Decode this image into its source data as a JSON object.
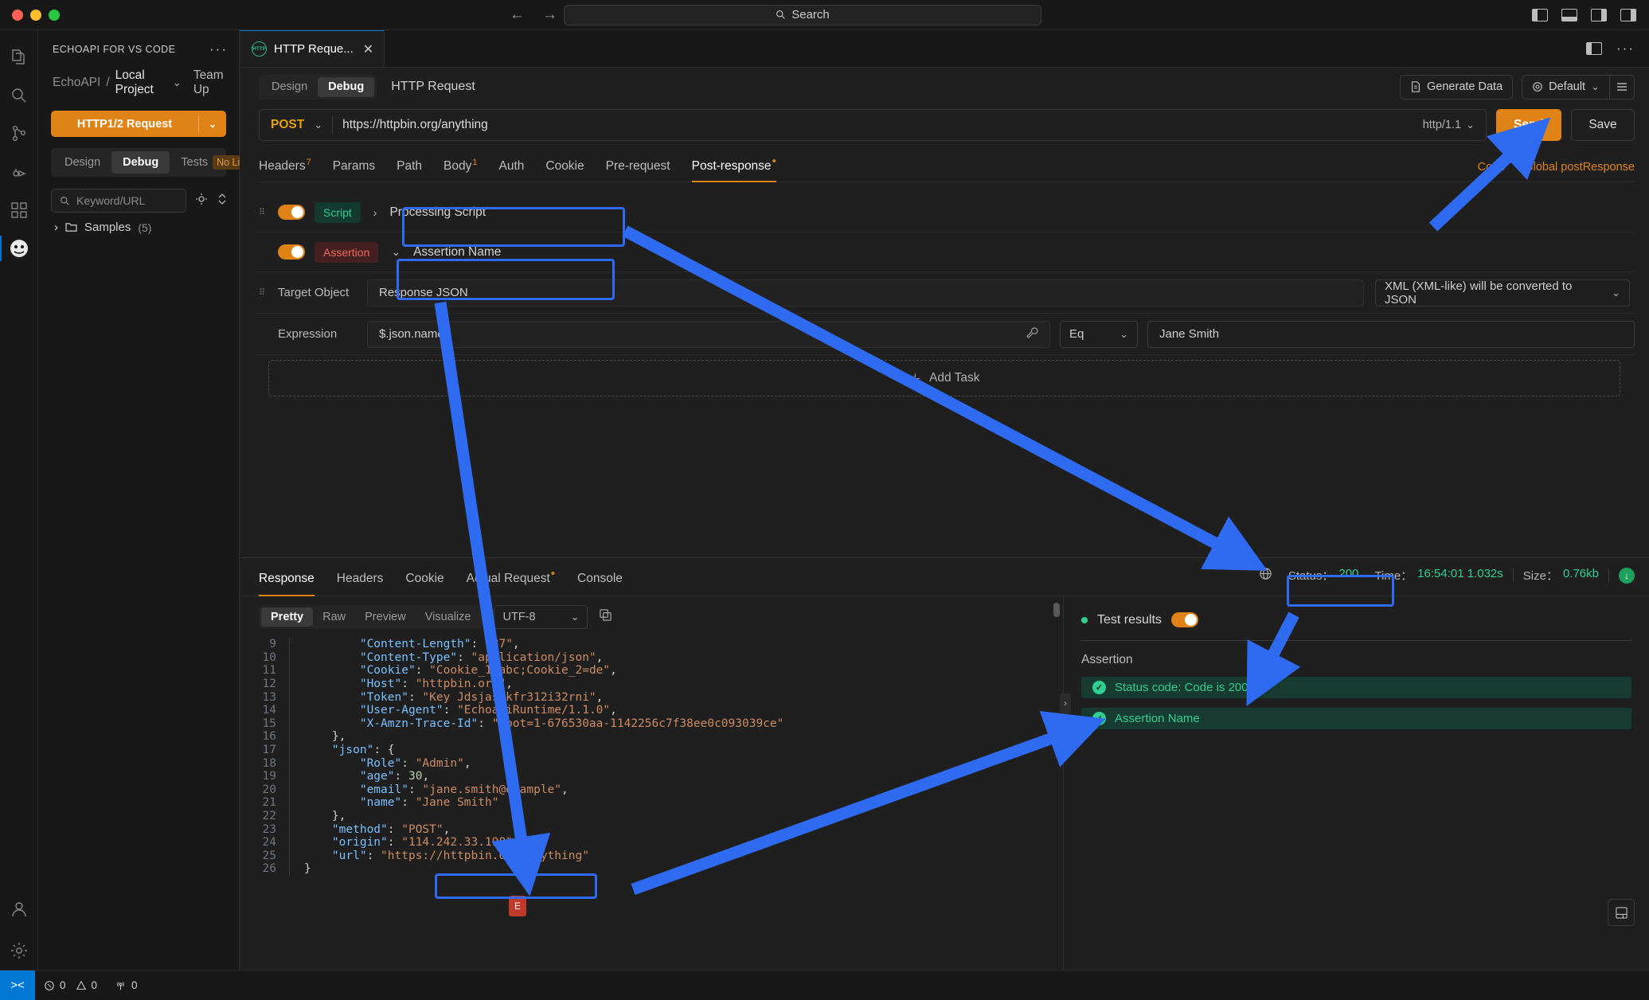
{
  "titlebar": {
    "search_placeholder": "Search",
    "back_icon": "arrow-left-icon",
    "forward_icon": "arrow-right-icon"
  },
  "sidebar": {
    "title": "ECHOAPI FOR VS CODE",
    "more_label": "···",
    "breadcrumb": {
      "root": "EchoAPI",
      "separator": "/",
      "project": "Local Project",
      "team_up": "Team Up"
    },
    "new_button": {
      "label": "HTTP1/2 Request",
      "caret": "⌄"
    },
    "segments": [
      {
        "label": "Design",
        "active": false
      },
      {
        "label": "Debug",
        "active": true
      },
      {
        "label": "Tests",
        "badge": "No Limits",
        "active": false
      }
    ],
    "search_placeholder": "Keyword/URL",
    "tree": [
      {
        "label": "Samples",
        "count": "(5)"
      }
    ]
  },
  "activity_items": [
    "explorer-icon",
    "search-icon",
    "source-control-icon",
    "run-debug-icon",
    "extensions-icon",
    "echoapi-icon",
    "account-icon",
    "settings-icon"
  ],
  "editor": {
    "tab": {
      "label": "HTTP Reque...",
      "icon": "http-icon",
      "close": "✕"
    },
    "mode_segments": [
      {
        "label": "Design",
        "active": false
      },
      {
        "label": "Debug",
        "active": true
      }
    ],
    "request_title": "HTTP Request",
    "generate_data": "Generate Data",
    "environment": "Default",
    "url_bar": {
      "method": "POST",
      "url": "https://httpbin.org/anything",
      "protocol": "http/1.1",
      "send": "Send",
      "save": "Save"
    },
    "request_tabs": [
      {
        "label": "Headers",
        "sup": "7",
        "active": false
      },
      {
        "label": "Params",
        "sup": "",
        "active": false
      },
      {
        "label": "Path",
        "sup": "",
        "active": false
      },
      {
        "label": "Body",
        "sup": "1",
        "active": false
      },
      {
        "label": "Auth",
        "sup": "",
        "active": false
      },
      {
        "label": "Cookie",
        "sup": "",
        "active": false
      },
      {
        "label": "Pre-request",
        "sup": "",
        "active": false
      },
      {
        "label": "Post-response",
        "sup": "•",
        "active": true
      }
    ],
    "tab_links": [
      "Code",
      "Global postResponse"
    ]
  },
  "tasks": {
    "script_row": {
      "chip": "Script",
      "arrow": "›",
      "name": "Processing Script"
    },
    "assertion_row": {
      "chip": "Assertion",
      "arrow": "⌄",
      "name": "Assertion Name"
    },
    "target_object": {
      "label": "Target Object",
      "value": "Response JSON",
      "note": "XML (XML-like) will be converted to JSON"
    },
    "expression": {
      "label": "Expression",
      "value": "$.json.name",
      "operator": "Eq",
      "expected": "Jane Smith"
    },
    "add_task": "Add Task"
  },
  "response": {
    "tabs": [
      {
        "label": "Response",
        "mark": "",
        "active": true
      },
      {
        "label": "Headers",
        "mark": "",
        "active": false
      },
      {
        "label": "Cookie",
        "mark": "",
        "active": false
      },
      {
        "label": "Actual Request",
        "mark": "•",
        "active": false
      },
      {
        "label": "Console",
        "mark": "",
        "active": false
      }
    ],
    "meta": {
      "status_label": "Status：",
      "status_value": "200",
      "time_label": "Time：",
      "time_value": "16:54:01 1.032s",
      "size_label": "Size：",
      "size_value": "0.76kb"
    },
    "format_segments": [
      {
        "label": "Pretty",
        "active": true
      },
      {
        "label": "Raw",
        "active": false
      },
      {
        "label": "Preview",
        "active": false
      },
      {
        "label": "Visualize",
        "active": false
      }
    ],
    "encoding": "UTF-8",
    "code_lines": [
      {
        "n": "9",
        "indent": 4,
        "text": "\"Content-Length\": \"87\","
      },
      {
        "n": "10",
        "indent": 4,
        "text": "\"Content-Type\": \"application/json\","
      },
      {
        "n": "11",
        "indent": 4,
        "text": "\"Cookie\": \"Cookie_1=abc;Cookie_2=de\","
      },
      {
        "n": "12",
        "indent": 4,
        "text": "\"Host\": \"httpbin.org\","
      },
      {
        "n": "13",
        "indent": 4,
        "text": "\"Token\": \"Key Jdsjasnkfr312i32rni\","
      },
      {
        "n": "14",
        "indent": 4,
        "text": "\"User-Agent\": \"EchoapiRuntime/1.1.0\","
      },
      {
        "n": "15",
        "indent": 4,
        "text": "\"X-Amzn-Trace-Id\": \"Root=1-676530aa-1142256c7f38ee0c093039ce\""
      },
      {
        "n": "16",
        "indent": 2,
        "text": "},"
      },
      {
        "n": "17",
        "indent": 2,
        "text": "\"json\": {"
      },
      {
        "n": "18",
        "indent": 4,
        "text": "\"Role\": \"Admin\","
      },
      {
        "n": "19",
        "indent": 4,
        "text": "\"age\": 30,"
      },
      {
        "n": "20",
        "indent": 4,
        "text": "\"email\": \"jane.smith@example\","
      },
      {
        "n": "21",
        "indent": 4,
        "text": "\"name\": \"Jane Smith\""
      },
      {
        "n": "22",
        "indent": 2,
        "text": "},"
      },
      {
        "n": "23",
        "indent": 2,
        "text": "\"method\": \"POST\","
      },
      {
        "n": "24",
        "indent": 2,
        "text": "\"origin\": \"114.242.33.198\","
      },
      {
        "n": "25",
        "indent": 2,
        "text": "\"url\": \"https://httpbin.org/anything\""
      },
      {
        "n": "26",
        "indent": 0,
        "text": "}"
      }
    ],
    "test_results": {
      "title": "Test results",
      "group": "Assertion",
      "items": [
        {
          "label": "Status code: Code is 200",
          "passed": true
        },
        {
          "label": "Assertion Name",
          "passed": true
        }
      ]
    }
  },
  "statusbar": {
    "remote_icon": "remote-icon",
    "errors": "0",
    "warnings": "0",
    "ports": "0"
  },
  "colors": {
    "accent_orange": "#e08316",
    "success_green": "#2ecf92",
    "annotation_blue": "#2f6bf0",
    "vscode_blue": "#0078d4"
  }
}
